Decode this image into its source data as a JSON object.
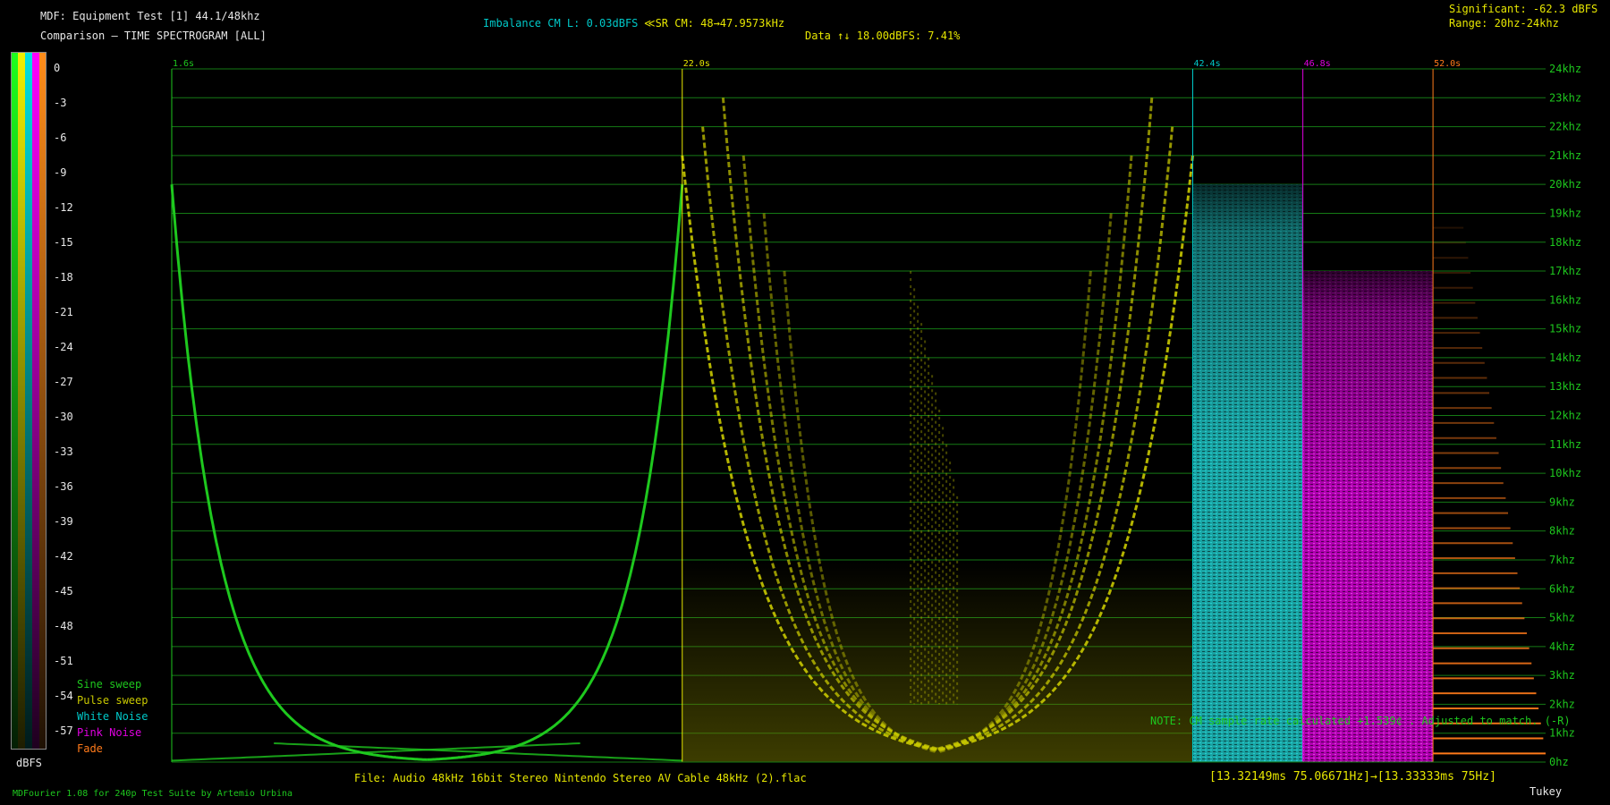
{
  "header": {
    "title": "MDF: Equipment Test [1] 44.1/48khz",
    "subtitle": "Comparison — TIME SPECTROGRAM [ALL]",
    "imbalance": "Imbalance CM L: 0.03dBFS",
    "sample_rate": "≪SR CM: 48→47.9573kHz",
    "data": "Data ↑↓ 18.00dBFS: 7.41%",
    "significant": "Significant: -62.3 dBFS",
    "range": "Range: 20hz-24khz"
  },
  "footer": {
    "file": "File: Audio   48kHz 16bit Stereo Nintendo Stereo AV Cable 48kHz (2).flac",
    "timing": "[13.32149ms 75.06671Hz]→[13.33333ms 75Hz]",
    "note": "NOTE: CM sample rate calculated +1.539¢ . Adjusted to match. (-R)",
    "credits": "MDFourier 1.08 for 240p Test Suite by Artemio Urbina",
    "window": "Tukey"
  },
  "scale": {
    "unit": "dBFS",
    "ticks": [
      "0",
      "-3",
      "-6",
      "-9",
      "-12",
      "-15",
      "-18",
      "-21",
      "-24",
      "-27",
      "-30",
      "-33",
      "-36",
      "-39",
      "-42",
      "-45",
      "-48",
      "-51",
      "-54",
      "-57"
    ],
    "colors": [
      "#1eff1e",
      "#f0f000",
      "#00e0e0",
      "#ff00ff",
      "#ff8c1a"
    ]
  },
  "legend": [
    {
      "label": "Sine sweep",
      "color": "#1ec81e"
    },
    {
      "label": "Pulse sweep",
      "color": "#c8c800"
    },
    {
      "label": "White Noise",
      "color": "#00c8c8"
    },
    {
      "label": "Pink Noise",
      "color": "#e000e0"
    },
    {
      "label": "Fade",
      "color": "#ff7a1a"
    }
  ],
  "chart_data": {
    "type": "heatmap",
    "title": "TIME SPECTROGRAM [ALL]",
    "ylabel": "",
    "xlabel": "",
    "ylim": [
      0,
      24
    ],
    "xlim": [
      1.6,
      56.5
    ],
    "y_ticks": [
      "0hz",
      "1khz",
      "2khz",
      "3khz",
      "4khz",
      "5khz",
      "6khz",
      "7khz",
      "8khz",
      "9khz",
      "10khz",
      "11khz",
      "12khz",
      "13khz",
      "14khz",
      "15khz",
      "16khz",
      "17khz",
      "18khz",
      "19khz",
      "20khz",
      "21khz",
      "22khz",
      "23khz",
      "24khz"
    ],
    "block_markers": [
      {
        "label": "1.6s",
        "t": 1.6,
        "color": "#1ec81e"
      },
      {
        "label": "22.0s",
        "t": 22.0,
        "color": "#e6e600"
      },
      {
        "label": "42.4s",
        "t": 42.4,
        "color": "#00c8c8"
      },
      {
        "label": "46.8s",
        "t": 46.8,
        "color": "#e000e0"
      },
      {
        "label": "52.0s",
        "t": 52.0,
        "color": "#ff7a1a"
      }
    ],
    "series": [
      {
        "name": "Sine sweep",
        "start": 1.6,
        "end": 22.0,
        "color": "#1ec81e"
      },
      {
        "name": "Pulse sweep",
        "start": 22.0,
        "end": 42.4,
        "color": "#c8c800"
      },
      {
        "name": "White Noise",
        "start": 42.4,
        "end": 46.8,
        "color": "#00c8c8",
        "max_khz": 20
      },
      {
        "name": "Pink Noise",
        "start": 46.8,
        "end": 52.0,
        "color": "#e000e0",
        "max_khz": 17
      },
      {
        "name": "Fade",
        "start": 52.0,
        "end": 56.5,
        "color": "#ff7a1a"
      }
    ]
  }
}
